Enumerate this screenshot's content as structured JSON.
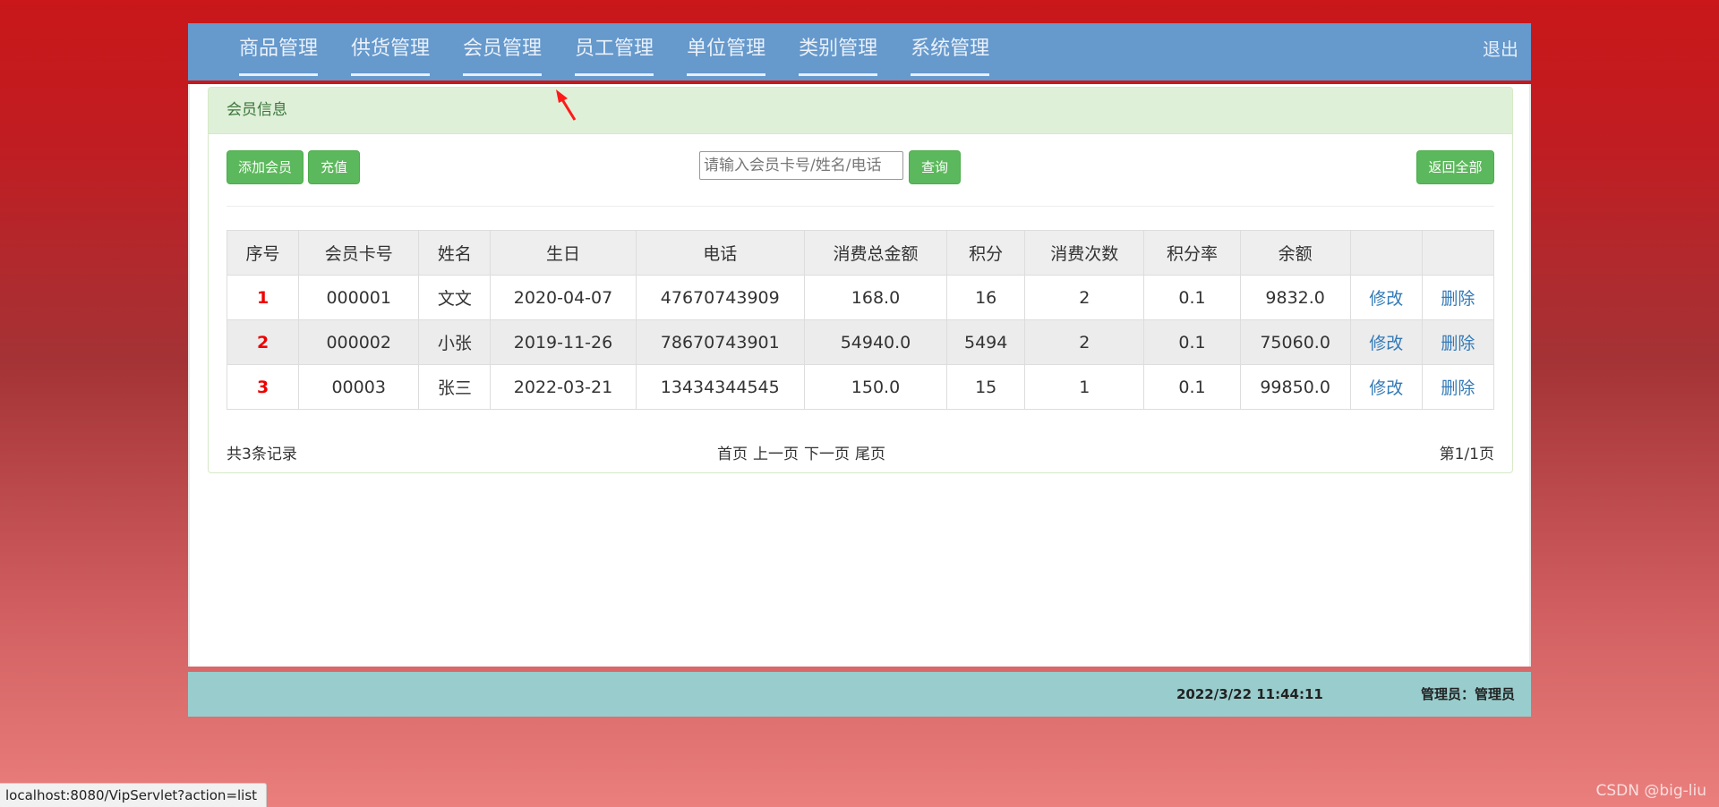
{
  "nav": {
    "items": [
      "商品管理",
      "供货管理",
      "会员管理",
      "员工管理",
      "单位管理",
      "类别管理",
      "系统管理"
    ],
    "logout": "退出"
  },
  "panel": {
    "heading": "会员信息",
    "toolbar": {
      "add_label": "添加会员",
      "recharge_label": "充值",
      "search_placeholder": "请输入会员卡号/姓名/电话",
      "search_label": "查询",
      "reset_label": "返回全部"
    },
    "table": {
      "headers": [
        "序号",
        "会员卡号",
        "姓名",
        "生日",
        "电话",
        "消费总金额",
        "积分",
        "消费次数",
        "积分率",
        "余额",
        "",
        ""
      ],
      "rows": [
        {
          "no": "1",
          "card": "000001",
          "name": "文文",
          "birthday": "2020-04-07",
          "phone": "47670743909",
          "total": "168.0",
          "points": "16",
          "count": "2",
          "rate": "0.1",
          "balance": "9832.0",
          "edit": "修改",
          "delete": "删除"
        },
        {
          "no": "2",
          "card": "000002",
          "name": "小张",
          "birthday": "2019-11-26",
          "phone": "78670743901",
          "total": "54940.0",
          "points": "5494",
          "count": "2",
          "rate": "0.1",
          "balance": "75060.0",
          "edit": "修改",
          "delete": "删除"
        },
        {
          "no": "3",
          "card": "00003",
          "name": "张三",
          "birthday": "2022-03-21",
          "phone": "13434344545",
          "total": "150.0",
          "points": "15",
          "count": "1",
          "rate": "0.1",
          "balance": "99850.0",
          "edit": "修改",
          "delete": "删除"
        }
      ]
    },
    "footer": {
      "record_count": "共3条记录",
      "first": "首页",
      "prev": "上一页",
      "next": "下一页",
      "last": "尾页",
      "page_info": "第1/1页"
    }
  },
  "status_bar": {
    "datetime": "2022/3/22 11:44:11",
    "admin": "管理员：管理员"
  },
  "browser": {
    "status_url": "localhost:8080/VipServlet?action=list"
  },
  "watermark": "CSDN @big-liu",
  "colors": {
    "nav_bg": "#6699cc",
    "heading_bg": "#dff0d8",
    "button_green": "#5cb85c",
    "link_blue": "#337ab7",
    "index_red": "#ee0000",
    "bottom_bar_bg": "#99cccc"
  }
}
